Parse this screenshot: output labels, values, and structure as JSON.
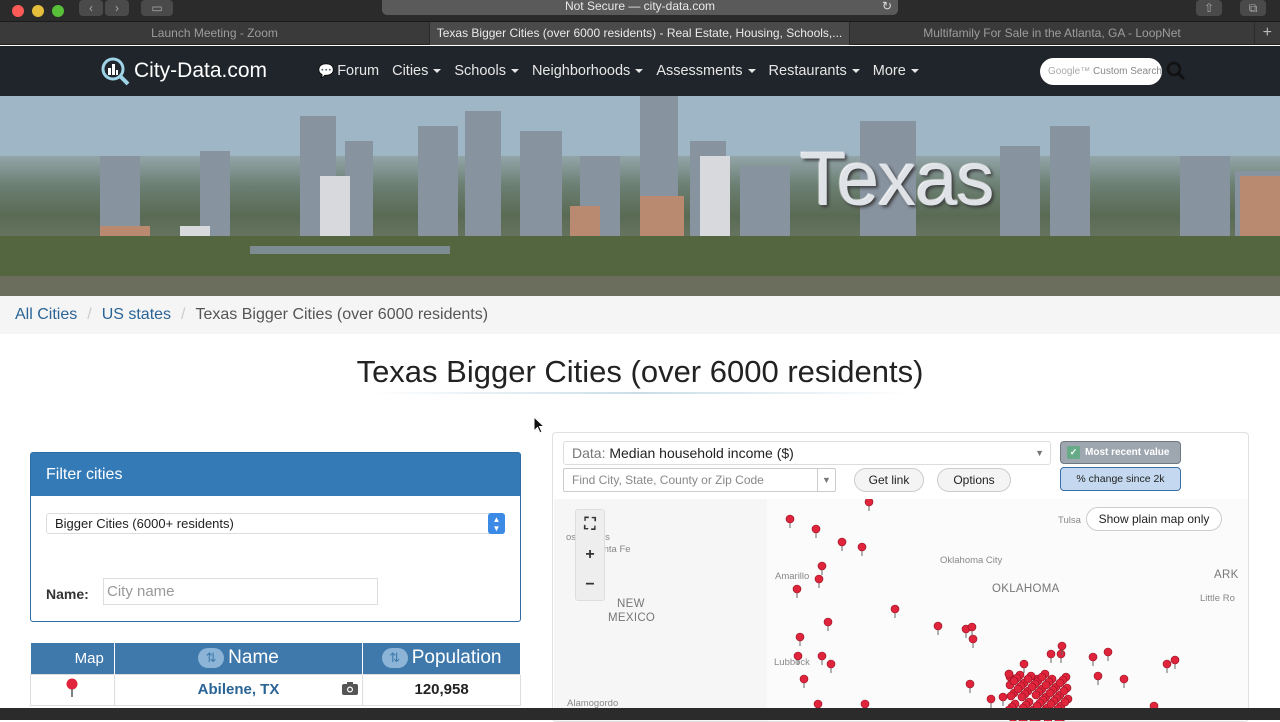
{
  "browser": {
    "address": "Not Secure — city-data.com",
    "tabs": [
      {
        "title": "Launch Meeting - Zoom"
      },
      {
        "title": "Texas Bigger Cities (over 6000 residents) - Real Estate, Housing, Schools,..."
      },
      {
        "title": "Multifamily For Sale in the Atlanta, GA - LoopNet"
      }
    ]
  },
  "site": {
    "logo_text": "City-Data.com",
    "nav": [
      "Forum",
      "Cities",
      "Schools",
      "Neighborhoods",
      "Assessments",
      "Restaurants",
      "More"
    ],
    "search_placeholder": "Custom Search",
    "search_brand": "Google™"
  },
  "hero": {
    "title": "Texas"
  },
  "breadcrumb": {
    "items": [
      "All Cities",
      "US states"
    ],
    "current": "Texas Bigger Cities (over 6000 residents)"
  },
  "page_title": "Texas Bigger Cities (over 6000 residents)",
  "filter": {
    "heading": "Filter cities",
    "select_value": "Bigger Cities (6000+ residents)",
    "name_label": "Name:",
    "name_placeholder": "City name"
  },
  "table": {
    "headers": {
      "map": "Map",
      "name": "Name",
      "population": "Population"
    },
    "rows": [
      {
        "name": "Abilene, TX",
        "population": "120,958"
      }
    ]
  },
  "map": {
    "data_label": "Data:",
    "data_value": "Median household income ($)",
    "recent_button": "Most recent value",
    "change_button": "% change since 2k",
    "find_placeholder": "Find City, State, County or Zip Code",
    "get_link": "Get link",
    "options": "Options",
    "plain_map": "Show plain map only",
    "labels": [
      "Santa Fe",
      "Amarillo",
      "Oklahoma City",
      "OKLAHOMA",
      "Tulsa",
      "ARK",
      "Little Ro",
      "NEW",
      "MEXICO",
      "Lubbock",
      "Alamogordo",
      "os Alamos"
    ]
  }
}
